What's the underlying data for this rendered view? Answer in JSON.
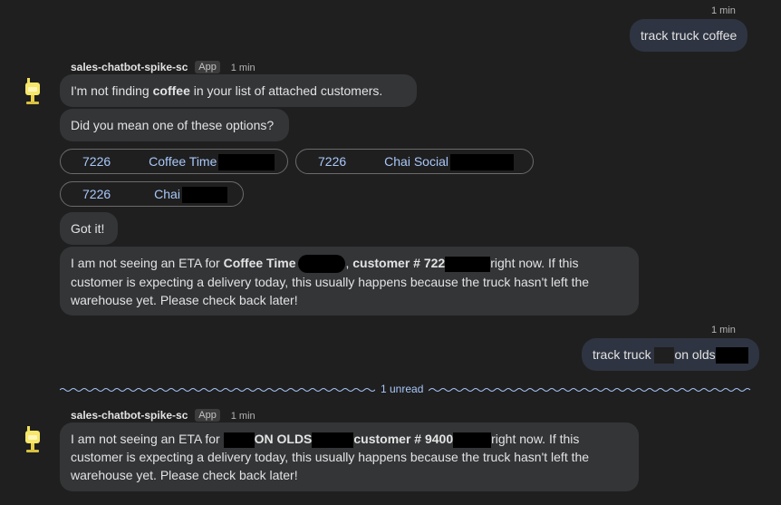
{
  "messages": {
    "user1": {
      "time": "1 min",
      "text": "track truck coffee"
    },
    "bot_header1": {
      "sender": "sales-chatbot-spike-sc",
      "badge": "App",
      "time": "1 min"
    },
    "bot_msg1": {
      "prefix": "I'm not finding ",
      "bold": "coffee",
      "suffix": " in your list of attached customers."
    },
    "bot_msg2": {
      "text": "Did you mean one of these options?"
    },
    "options": [
      {
        "num": "7226",
        "name": "Coffee Time"
      },
      {
        "num": "7226",
        "name": "Chai Social"
      },
      {
        "num": "7226",
        "name": "Chai"
      }
    ],
    "bot_msg3": {
      "text": "Got it!"
    },
    "bot_msg4": {
      "part1": "I am not seeing an ETA for ",
      "bold_name": "Coffee Time",
      "part2": ", ",
      "bold_customer": "customer # 722",
      "part3": "right now. If this",
      "line2": "customer is expecting a delivery today, this usually happens because the truck hasn't left the",
      "line3": "warehouse yet. Please check back later!"
    },
    "user2": {
      "time": "1 min",
      "text_a": "track truck ",
      "text_b": "on olds"
    },
    "unread": {
      "label": "1 unread"
    },
    "bot_header2": {
      "sender": "sales-chatbot-spike-sc",
      "badge": "App",
      "time": "1 min"
    },
    "bot_msg5": {
      "part1": "I am not seeing an ETA for ",
      "bold_name": "ON OLDS",
      "bold_customer": "customer # 9400",
      "part3": "right now. If this",
      "line2": "customer is expecting a delivery today, this usually happens because the truck hasn't left the",
      "line3": "warehouse yet. Please check back later!"
    }
  },
  "colors": {
    "background": "#1f1f1f",
    "user_bubble": "#2e3441",
    "bot_bubble": "#333537",
    "link": "#a8c7fa"
  },
  "icons": {
    "avatar": "lamp-bot-avatar-icon"
  }
}
